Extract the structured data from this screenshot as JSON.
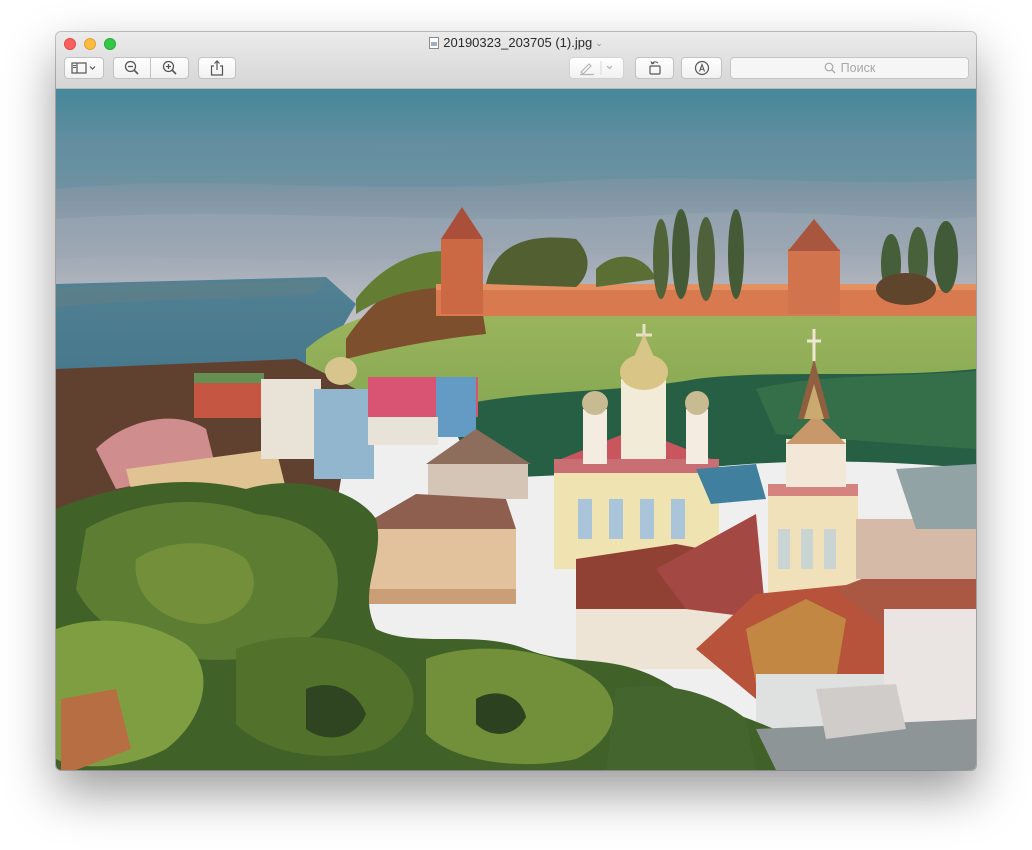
{
  "window": {
    "title": "20190323_203705 (1).jpg",
    "document_icon": "jpeg-file-icon",
    "title_menu_icon": "chevron-down-icon"
  },
  "traffic_lights": {
    "close": "#fc605c",
    "minimize": "#fdbc40",
    "zoom": "#34c84a"
  },
  "toolbar": {
    "sidebar_button_icon": "sidebar-icon",
    "zoom_out_icon": "zoom-out-icon",
    "zoom_in_icon": "zoom-in-icon",
    "share_icon": "share-icon",
    "markup_highlight_icon": "pen-icon",
    "markup_menu_icon": "chevron-down-icon",
    "rotate_icon": "rotate-icon",
    "annotate_icon": "markup-circle-icon",
    "search_placeholder": "Поиск"
  },
  "image": {
    "subject": "oil-painting-russian-monastery-landscape"
  }
}
